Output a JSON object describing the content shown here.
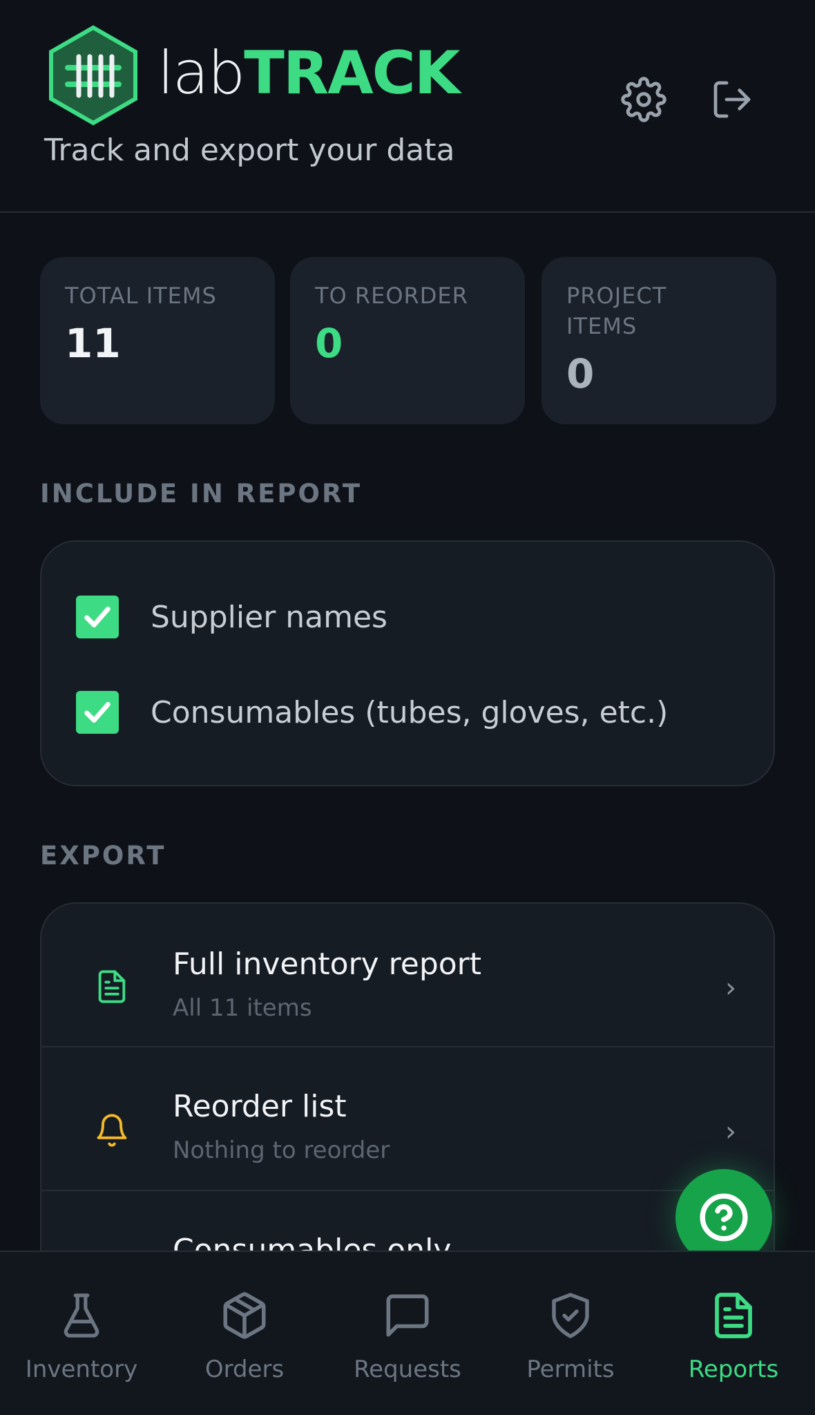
{
  "header": {
    "brand_part1": "lab",
    "brand_part2": "TRACK",
    "tagline": "Track and export your data"
  },
  "stats": [
    {
      "label": "TOTAL ITEMS",
      "value": "11",
      "color": "#f2f4f7"
    },
    {
      "label": "TO REORDER",
      "value": "0",
      "color": "#3ddc84"
    },
    {
      "label": "PROJECT ITEMS",
      "value": "0",
      "color": "#aab2bb"
    }
  ],
  "include": {
    "title": "INCLUDE IN REPORT",
    "options": [
      {
        "label": "Supplier names",
        "checked": true
      },
      {
        "label": "Consumables (tubes, gloves, etc.)",
        "checked": true
      }
    ]
  },
  "export": {
    "title": "EXPORT",
    "items": [
      {
        "title": "Full inventory report",
        "subtitle": "All 11 items",
        "icon": "document-icon"
      },
      {
        "title": "Reorder list",
        "subtitle": "Nothing to reorder",
        "icon": "bell-icon"
      },
      {
        "title": "Consumables only",
        "subtitle": "",
        "icon": ""
      }
    ],
    "chevron": "›"
  },
  "nav": {
    "items": [
      {
        "label": "Inventory",
        "icon": "flask-icon",
        "active": false
      },
      {
        "label": "Orders",
        "icon": "box-icon",
        "active": false
      },
      {
        "label": "Requests",
        "icon": "chat-bubble-icon",
        "active": false
      },
      {
        "label": "Permits",
        "icon": "shield-check-icon",
        "active": false
      },
      {
        "label": "Reports",
        "icon": "document-icon",
        "active": true
      }
    ]
  },
  "colors": {
    "accent": "#3ddc84",
    "background": "#0e1218",
    "card": "#1a212b",
    "warning": "#f5b829"
  }
}
